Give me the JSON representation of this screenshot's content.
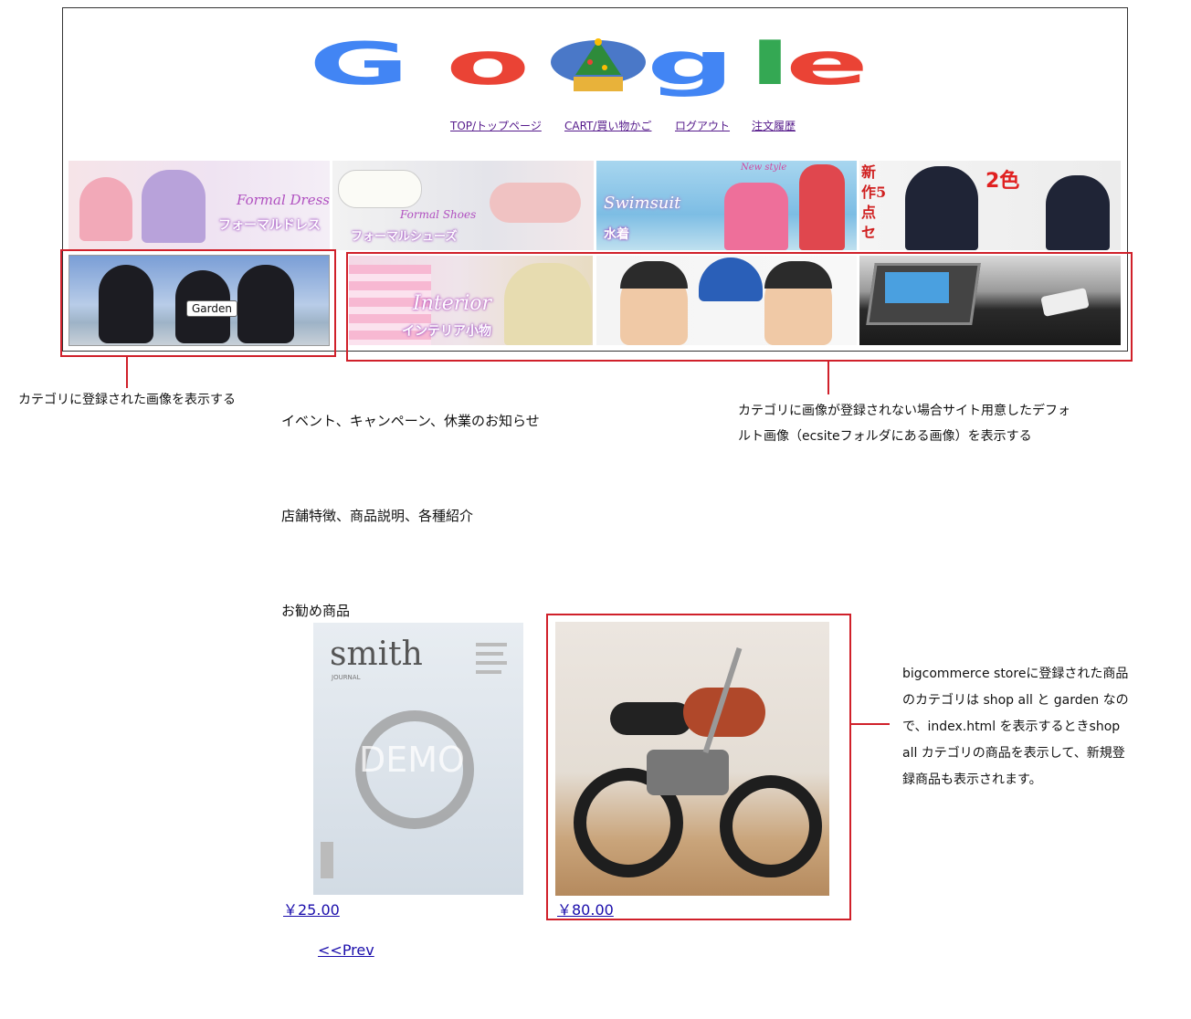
{
  "logo": {
    "letters": [
      "G",
      "o",
      "o",
      "g",
      "l",
      "e"
    ],
    "colors": [
      "#4285F4",
      "#EA4335",
      "#FBBC05",
      "#4285F4",
      "#34A853",
      "#EA4335"
    ]
  },
  "nav": {
    "items": [
      "TOP/トップページ",
      "CART/買い物かご",
      "ログアウト",
      "注文履歴"
    ]
  },
  "categories_row1": [
    {
      "caption": "Formal Dress",
      "jp": "フォーマルドレス"
    },
    {
      "caption": "Formal Shoes",
      "jp": "フォーマルシューズ"
    },
    {
      "caption": "Swimsuit",
      "jp": "水着",
      "tag": "New style"
    },
    {
      "jp_vertical": "新作5点セ",
      "badge": "2色"
    }
  ],
  "categories_row2": [
    {
      "tooltip": "Garden"
    },
    {
      "caption": "Interior",
      "jp": "インテリア小物"
    },
    {},
    {}
  ],
  "annotations": {
    "left": "カテゴリに登録された画像を表示する",
    "right_line1": "カテゴリに画像が登録されない場合サイト用意したデフォ",
    "right_line2": "ルト画像（ecsiteフォルダにある画像）を表示する",
    "product": [
      "bigcommerce storeに登録された商品",
      "のカテゴリは shop all と garden なの",
      "で、index.html を表示するときshop",
      "all カテゴリの商品を表示して、新規登",
      "録商品も表示されます。"
    ]
  },
  "sections": {
    "events": "イベント、キャンペーン、休業のお知らせ",
    "shop": "店舗特徴、商品説明、各種紹介",
    "recommended": "お勧め商品"
  },
  "products": [
    {
      "image_text": "smith",
      "image_sub": "JOURNAL",
      "watermark": "DEMO",
      "price": "￥25.00"
    },
    {
      "price": "￥80.00"
    }
  ],
  "pagination": {
    "prev": "<<Prev"
  },
  "colors": {
    "annotation_red": "#d0202a",
    "link": "#1a0dab"
  }
}
